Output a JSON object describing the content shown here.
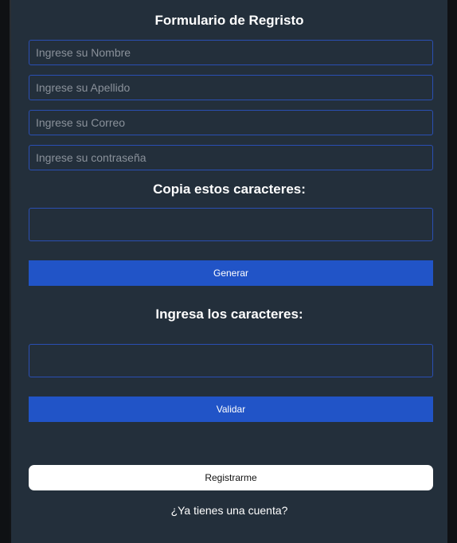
{
  "form": {
    "title": "Formulario de Regristo",
    "name_placeholder": "Ingrese su Nombre",
    "lastname_placeholder": "Ingrese su Apellido",
    "email_placeholder": "Ingrese su Correo",
    "password_placeholder": "Ingrese su contraseña"
  },
  "captcha": {
    "copy_heading": "Copia estos caracteres:",
    "code": "",
    "generate_label": "Generar",
    "enter_heading": "Ingresa los caracteres:",
    "input_value": "",
    "validate_label": "Validar"
  },
  "actions": {
    "register_label": "Registrarme",
    "login_link": "¿Ya tienes una cuenta?"
  },
  "colors": {
    "panel_bg": "#232f3b",
    "accent_blue": "#2154c7",
    "field_border": "#2a4fb3"
  }
}
